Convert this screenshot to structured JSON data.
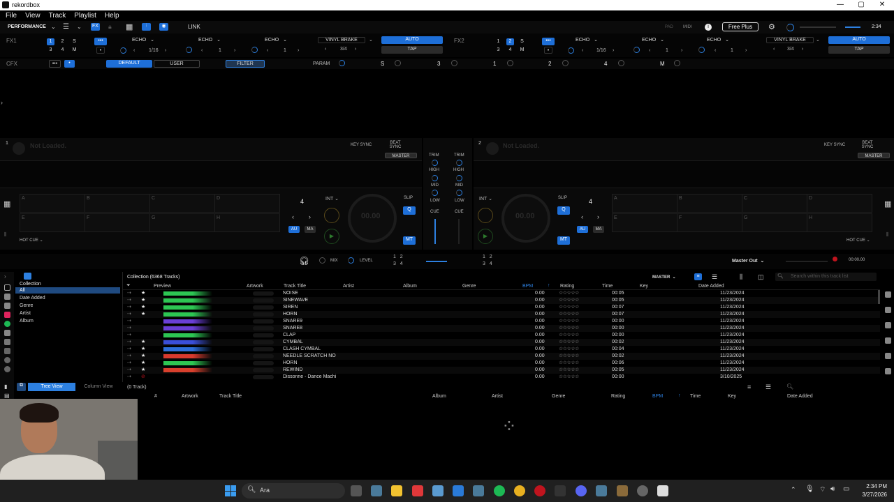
{
  "window": {
    "title": "rekordbox"
  },
  "menu": [
    "File",
    "View",
    "Track",
    "Playlist",
    "Help"
  ],
  "toolbar": {
    "mode": "PERFORMANCE",
    "fx_label": "FX",
    "link": "LINK",
    "pad_label": "PAD",
    "midi": "MIDI",
    "plan": "Free Plus",
    "time": "2:34"
  },
  "fx1": {
    "label": "FX1",
    "beat_nums": [
      "1",
      "2",
      "S",
      "3",
      "4",
      "M"
    ],
    "slots": [
      "ECHO",
      "ECHO",
      "ECHO"
    ],
    "beats": [
      "1/16",
      "1",
      "1"
    ],
    "brake": "VINYL BRAKE",
    "brake_beat": "3/4",
    "auto": "AUTO",
    "tap": "TAP"
  },
  "fx2": {
    "label": "FX2",
    "beat_nums": [
      "1",
      "2",
      "S",
      "3",
      "4",
      "M"
    ],
    "slots": [
      "ECHO",
      "ECHO",
      "ECHO"
    ],
    "beats": [
      "1/16",
      "1",
      "1"
    ],
    "brake": "VINYL BRAKE",
    "brake_beat": "3/4",
    "auto": "AUTO",
    "tap": "TAP"
  },
  "cfx": {
    "label": "CFX",
    "default": "DEFAULT",
    "user": "USER",
    "filter": "FILTER",
    "param": "PARAM",
    "s": "S",
    "nums": [
      "3",
      "1",
      "2",
      "4"
    ],
    "m": "M"
  },
  "deck1": {
    "num": "1",
    "status": "Not Loaded.",
    "key_sync": "KEY SYNC",
    "beat_sync": "BEAT SYNC",
    "master": "MASTER",
    "pads": [
      "A",
      "B",
      "C",
      "D",
      "E",
      "F",
      "G",
      "H"
    ],
    "hot_cue": "HOT CUE",
    "beat": "4",
    "int": "INT",
    "slip": "SLIP",
    "q": "Q",
    "au": "AU",
    "ma": "MA",
    "mt": "MT",
    "bpm": "00.00"
  },
  "deck2": {
    "num": "2",
    "status": "Not Loaded.",
    "key_sync": "KEY SYNC",
    "beat_sync": "BEAT SYNC",
    "master": "MASTER",
    "pads": [
      "A",
      "B",
      "C",
      "D",
      "E",
      "F",
      "G",
      "H"
    ],
    "hot_cue": "HOT CUE",
    "beat": "4",
    "int": "INT",
    "slip": "SLIP",
    "q": "Q",
    "au": "AU",
    "ma": "MA",
    "mt": "MT",
    "bpm": "00.00"
  },
  "mixer": {
    "trim": "TRIM",
    "high": "HIGH",
    "mid": "MID",
    "low": "LOW",
    "cue": "CUE"
  },
  "center_bar": {
    "mix": "MIX",
    "level": "LEVEL",
    "master_out": "Master Out",
    "rec_time": "00:00.00"
  },
  "browser": {
    "tree": [
      "Collection",
      "All",
      "Date Added",
      "Genre",
      "Artist",
      "Album"
    ],
    "collection_title": "Collection (6368 Tracks)",
    "master": "MASTER",
    "search_placeholder": "Search within this track list",
    "columns": [
      "Preview",
      "Artwork",
      "Track Title",
      "Artist",
      "Album",
      "Genre",
      "BPM",
      "Rating",
      "Time",
      "Key",
      "Date Added"
    ],
    "rows": [
      {
        "title": "NOISE",
        "bpm": "0.00",
        "time": "00:05",
        "date": "11/23/2024",
        "star": true,
        "wave": "#2dc653"
      },
      {
        "title": "SINEWAVE",
        "bpm": "0.00",
        "time": "00:05",
        "date": "11/23/2024",
        "star": true,
        "wave": "#2dc653"
      },
      {
        "title": "SIREN",
        "bpm": "0.00",
        "time": "00:07",
        "date": "11/23/2024",
        "star": true,
        "wave": "#2dc653"
      },
      {
        "title": "HORN",
        "bpm": "0.00",
        "time": "00:07",
        "date": "11/23/2024",
        "star": true,
        "wave": "#2dc653"
      },
      {
        "title": "SNARE9",
        "bpm": "0.00",
        "time": "00:00",
        "date": "11/23/2024",
        "star": false,
        "wave": "#6a3fd6"
      },
      {
        "title": "SNARE8",
        "bpm": "0.00",
        "time": "00:00",
        "date": "11/23/2024",
        "star": false,
        "wave": "#6a3fd6"
      },
      {
        "title": "CLAP",
        "bpm": "0.00",
        "time": "00:00",
        "date": "11/23/2024",
        "star": false,
        "wave": "#2dc653"
      },
      {
        "title": "CYMBAL",
        "bpm": "0.00",
        "time": "00:02",
        "date": "11/23/2024",
        "star": true,
        "wave": "#3a4fd8"
      },
      {
        "title": "CLASH CYMBAL",
        "bpm": "0.00",
        "time": "00:04",
        "date": "11/23/2024",
        "star": true,
        "wave": "#2d6fd8"
      },
      {
        "title": "NEEDLE SCRATCH NO",
        "bpm": "0.00",
        "time": "00:02",
        "date": "11/23/2024",
        "star": true,
        "wave": "#d83a2d"
      },
      {
        "title": "HORN",
        "bpm": "0.00",
        "time": "00:06",
        "date": "11/23/2024",
        "star": true,
        "wave": "#2dc653"
      },
      {
        "title": "REWIND",
        "bpm": "0.00",
        "time": "00:05",
        "date": "11/23/2024",
        "star": true,
        "wave": "#d8402d"
      },
      {
        "title": "Dissonne - Dance Machi",
        "bpm": "0.00",
        "time": "00:00",
        "date": "3/10/2025",
        "star": false,
        "wave": ""
      }
    ],
    "tree_view": "Tree View",
    "column_view": "Column View",
    "sub_count": "(0 Track)",
    "sub_columns": [
      "#",
      "Artwork",
      "Track Title",
      "Album",
      "Artist",
      "Genre",
      "Rating",
      "BPM",
      "Time",
      "Key",
      "Date Added"
    ]
  },
  "taskbar": {
    "search": "Ara",
    "time": "2:34 PM",
    "date": "3/27/2026"
  }
}
